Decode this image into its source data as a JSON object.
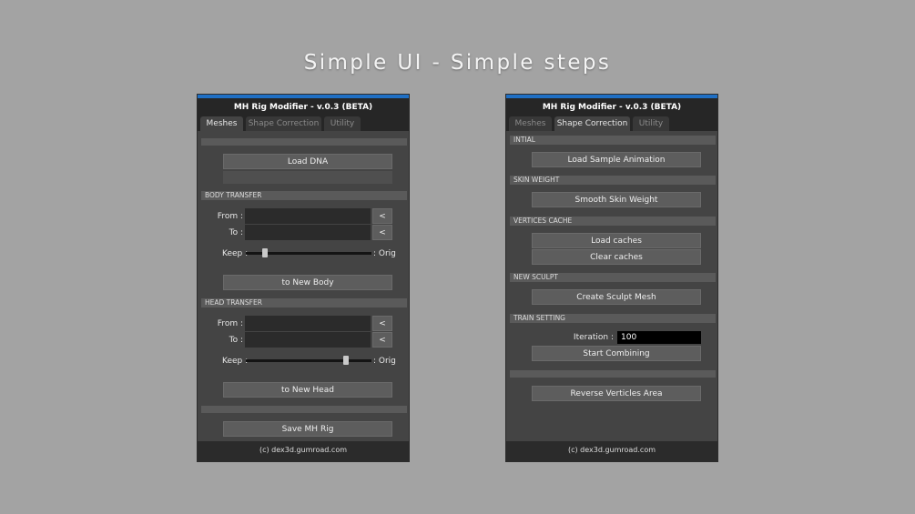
{
  "headline": "Simple UI - Simple steps",
  "colors": {
    "background": "#a3a3a3",
    "accent": "#1f6fc4",
    "panel": "#444444",
    "button": "#5d5d5d"
  },
  "panel_left": {
    "title": "MH Rig Modifier  -  v.0.3 (BETA)",
    "tabs": [
      {
        "label": "Meshes",
        "active": true
      },
      {
        "label": "Shape Correction",
        "active": false
      },
      {
        "label": "Utility",
        "active": false
      }
    ],
    "load_dna_label": "Load DNA",
    "body_transfer": {
      "header": "BODY TRANSFER",
      "from_label": "From :",
      "to_label": "To :",
      "pick_label": "<",
      "keep_label": "Keep :",
      "orig_label": ": Orig",
      "slider_value": 0.15,
      "button_label": "to New Body"
    },
    "head_transfer": {
      "header": "HEAD TRANSFER",
      "from_label": "From :",
      "to_label": "To :",
      "pick_label": "<",
      "keep_label": "Keep :",
      "orig_label": ": Orig",
      "slider_value": 0.8,
      "button_label": "to New Head"
    },
    "save_label": "Save MH Rig",
    "footer": "(c) dex3d.gumroad.com"
  },
  "panel_right": {
    "title": "MH Rig Modifier  -  v.0.3 (BETA)",
    "tabs": [
      {
        "label": "Meshes",
        "active": false
      },
      {
        "label": "Shape Correction",
        "active": true
      },
      {
        "label": "Utility",
        "active": false
      }
    ],
    "initial": {
      "header": "INTIAL",
      "button_label": "Load Sample Animation"
    },
    "skin_weight": {
      "header": "SKIN WEIGHT",
      "button_label": "Smooth Skin Weight"
    },
    "vertices_cache": {
      "header": "VERTICES CACHE",
      "load_label": "Load caches",
      "clear_label": "Clear caches"
    },
    "new_sculpt": {
      "header": "NEW SCULPT",
      "button_label": "Create Sculpt Mesh"
    },
    "train_setting": {
      "header": "TRAIN SETTING",
      "iteration_label": "Iteration :",
      "iteration_value": "100",
      "start_label": "Start Combining"
    },
    "reverse_label": "Reverse Verticles Area",
    "footer": "(c) dex3d.gumroad.com"
  }
}
